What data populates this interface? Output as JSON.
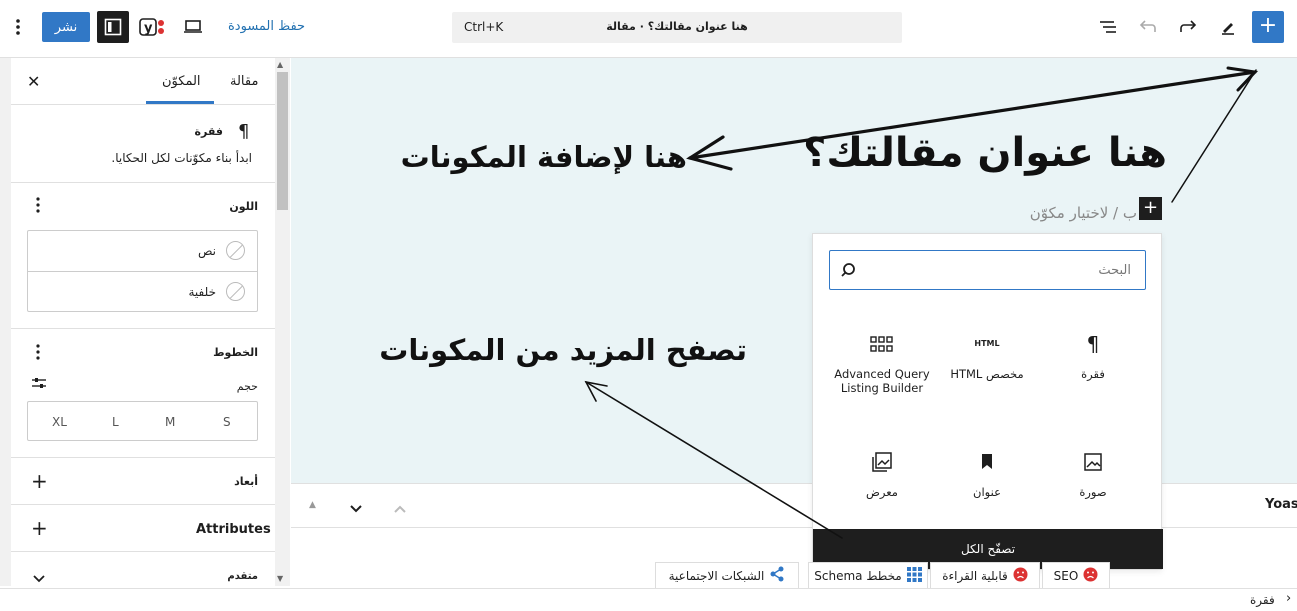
{
  "topbar": {
    "publish": "نشر",
    "save_draft": "حفظ المسودة",
    "command_title": "هنا عنوان مقالتك؟ · مقالة",
    "command_shortcut": "Ctrl+K",
    "add_label": "+",
    "yoast_logo": "y"
  },
  "sidebar": {
    "tabs": [
      {
        "label": "مقالة"
      },
      {
        "label": "المكوّن"
      }
    ],
    "close_icon": "close-icon",
    "block": {
      "name": "فقرة",
      "description": "ابدأ بناء مكوّنات لكل الحكايا."
    },
    "color": {
      "title": "اللون",
      "items": [
        {
          "label": "نص"
        },
        {
          "label": "خلفية"
        }
      ]
    },
    "typography": {
      "title": "الخطوط",
      "size_label": "حجم",
      "sizes": [
        "S",
        "M",
        "L",
        "XL"
      ]
    },
    "dimensions": {
      "title": "أبعاد"
    },
    "attributes": {
      "title": "Attributes"
    },
    "advanced": {
      "title": "متقدم"
    }
  },
  "canvas": {
    "post_title": "هنا عنوان مقالتك؟",
    "hint": "ب / لاختيار مكوّن",
    "annotation_add": "هنا لإضافة المكونات",
    "annotation_browse": "تصفح المزيد من المكونات"
  },
  "inserter": {
    "search_placeholder": "البحث",
    "blocks": [
      {
        "label": "فقرة",
        "icon": "paragraph-icon"
      },
      {
        "label": "HTML مخصص",
        "icon": "html-icon",
        "icon_text": "HTML"
      },
      {
        "label": "Advanced Query Listing Builder",
        "icon": "grid-icon"
      },
      {
        "label": "صورة",
        "icon": "image-icon"
      },
      {
        "label": "عنوان",
        "icon": "bookmark-icon"
      },
      {
        "label": "معرض",
        "icon": "gallery-icon"
      }
    ],
    "browse_all": "تصفّح الكل"
  },
  "panel": {
    "yoast_label": "Yoas"
  },
  "yoast_tabs": [
    {
      "label": "SEO"
    },
    {
      "label": "قابلية القراءة"
    },
    {
      "label": "مخطط Schema"
    },
    {
      "label": "الشبكات الاجتماعية"
    }
  ],
  "footer": {
    "breadcrumb": "فقرة"
  },
  "colors": {
    "accent": "#3178c6",
    "canvas_bg": "#eaf4f6",
    "error": "#dc3232"
  }
}
